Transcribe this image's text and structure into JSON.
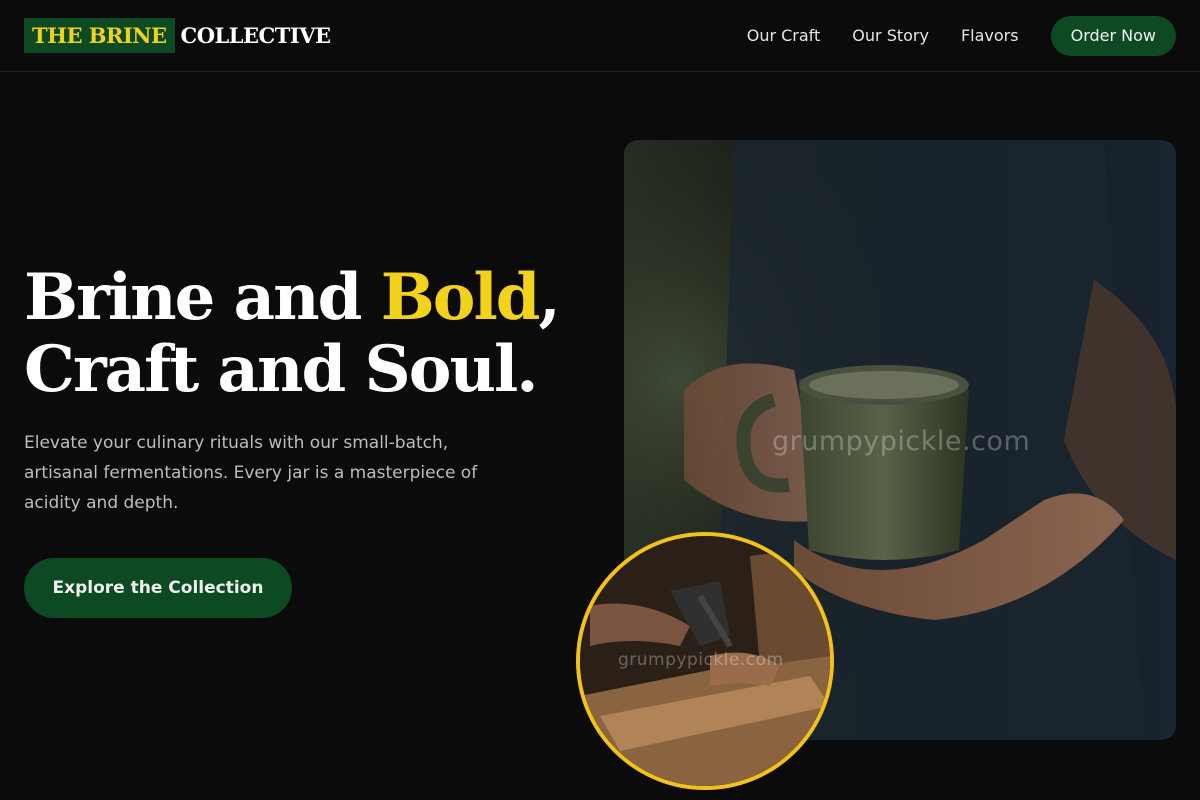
{
  "brand": {
    "highlight": "THE BRINE",
    "rest": "COLLECTIVE"
  },
  "nav": {
    "links": [
      "Our Craft",
      "Our Story",
      "Flavors"
    ],
    "cta": "Order Now"
  },
  "hero": {
    "headline_part1": "Brine and ",
    "headline_accent": "Bold",
    "headline_part2": ",",
    "headline_line2": "Craft and Soul.",
    "subtext": "Elevate your culinary rituals with our small-batch, artisanal fermentations. Every jar is a masterpiece of acidity and depth.",
    "cta": "Explore the Collection"
  },
  "images": {
    "main_watermark": "grumpypickle.com",
    "circle_watermark": "grumpypickle.com"
  },
  "colors": {
    "background": "#0b0b0b",
    "brand_green": "#0d4a24",
    "accent_yellow": "#f2d21b",
    "circle_border": "#f2c21b"
  }
}
